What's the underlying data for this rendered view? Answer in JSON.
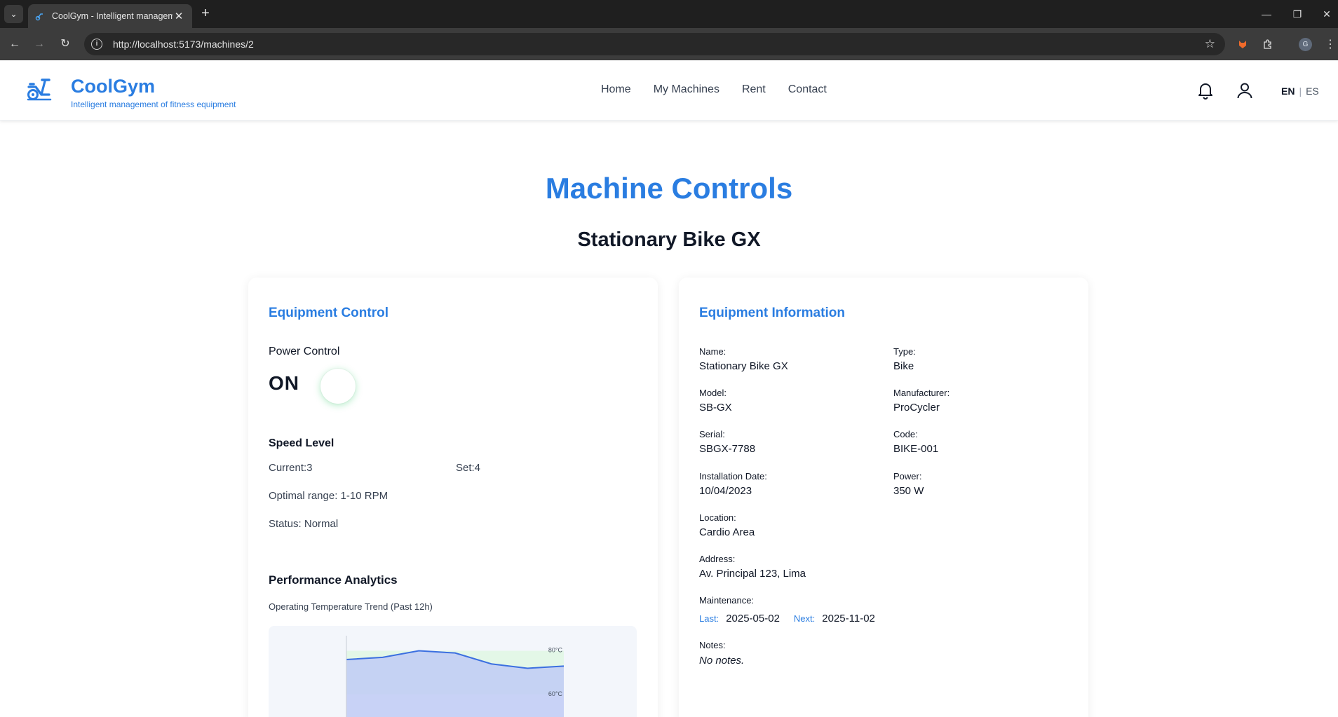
{
  "browser": {
    "tab_title": "CoolGym - Intelligent management of fitness equipment",
    "url": "http://localhost:5173/machines/2",
    "profile_initial": "G"
  },
  "header": {
    "brand_name": "CoolGym",
    "tagline": "Intelligent management of fitness equipment",
    "nav": [
      "Home",
      "My Machines",
      "Rent",
      "Contact"
    ],
    "lang_active": "EN",
    "lang_separator": "|",
    "lang_other": "ES"
  },
  "page": {
    "title": "Machine Controls",
    "machine_name": "Stationary Bike GX"
  },
  "control": {
    "title": "Equipment Control",
    "power_label": "Power Control",
    "power_state": "ON",
    "speed_title": "Speed Level",
    "current_text": "Current:3",
    "set_text": "Set:4",
    "optimal_text": "Optimal range: 1-10 RPM",
    "status_text": "Status: Normal",
    "analytics_title": "Performance Analytics",
    "analytics_subtitle": "Operating Temperature Trend (Past 12h)"
  },
  "chart_data": {
    "type": "area",
    "title": "Operating Temperature Trend (Past 12h)",
    "series": [
      {
        "values": [
          76,
          77,
          80,
          79,
          74,
          72,
          73
        ]
      }
    ],
    "reference_lines": [
      {
        "label": "80°C",
        "value": 80
      },
      {
        "label": "60°C",
        "value": 60
      }
    ],
    "optimal_band": [
      60,
      80
    ],
    "ylim": [
      40,
      85
    ],
    "colors": {
      "line": "#3b6fe0",
      "fill": "#bfcbf5",
      "band": "#e3f7e7"
    }
  },
  "info": {
    "title": "Equipment Information",
    "name_label": "Name:",
    "name_value": "Stationary Bike GX",
    "type_label": "Type:",
    "type_value": "Bike",
    "model_label": "Model:",
    "model_value": "SB-GX",
    "manufacturer_label": "Manufacturer:",
    "manufacturer_value": "ProCycler",
    "serial_label": "Serial:",
    "serial_value": "SBGX-7788",
    "code_label": "Code:",
    "code_value": "BIKE-001",
    "install_label": "Installation Date:",
    "install_value": "10/04/2023",
    "power_label": "Power:",
    "power_value": "350 W",
    "location_label": "Location:",
    "location_value": "Cardio Area",
    "address_label": "Address:",
    "address_value": "Av. Principal 123, Lima",
    "maintenance_label": "Maintenance:",
    "last_label": "Last:",
    "last_value": "2025-05-02",
    "next_label": "Next:",
    "next_value": "2025-11-02",
    "notes_label": "Notes:",
    "notes_value": "No notes."
  },
  "colors": {
    "accent": "#2a7de1",
    "power_on_glow": "#22c55e"
  }
}
